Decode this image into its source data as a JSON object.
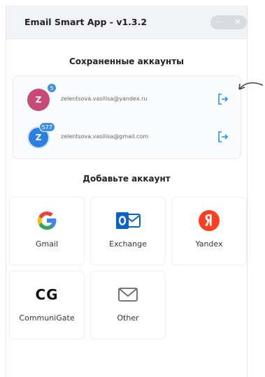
{
  "window": {
    "title": "Email Smart App - v1.3.2",
    "controls": [
      "···",
      "✕"
    ]
  },
  "saved": {
    "heading": "Сохраненные аккаунты",
    "accounts": [
      {
        "initial": "Z",
        "badge": "5",
        "email": "zelentsova.vasilisa@yandex.ru",
        "color": "#c64a74"
      },
      {
        "initial": "Z",
        "badge": "577",
        "email": "zelentsova.vasilisa@gmail.com",
        "color": "#2d7fe0"
      }
    ]
  },
  "add": {
    "heading": "Добавьте аккаунт",
    "providers": [
      {
        "label": "Gmail",
        "icon": "google-g-icon"
      },
      {
        "label": "Exchange",
        "icon": "outlook-icon"
      },
      {
        "label": "Yandex",
        "icon": "yandex-icon"
      },
      {
        "label": "CommuniGate",
        "icon": "communigate-icon",
        "logo_text": "CG"
      },
      {
        "label": "Other",
        "icon": "envelope-icon"
      }
    ]
  },
  "colors": {
    "accent": "#2d8ee6",
    "yandex": "#fc3f1d",
    "outlook": "#0a64c8"
  }
}
